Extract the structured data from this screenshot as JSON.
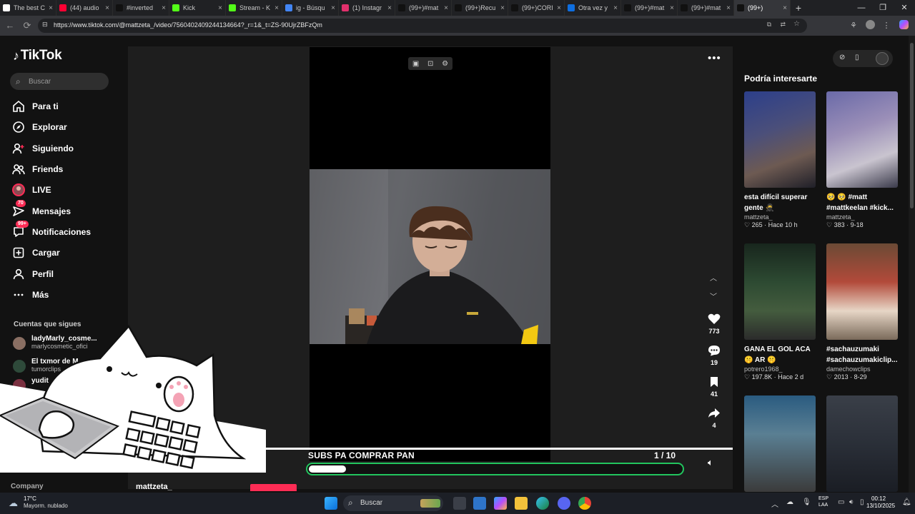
{
  "browser": {
    "tabs": [
      {
        "label": "The best C",
        "fav_color": "#444"
      },
      {
        "label": "The best C",
        "fav_color": "#fff"
      },
      {
        "label": "(44) audio",
        "fav_color": "#ff0033"
      },
      {
        "label": "#inverted",
        "fav_color": "#111"
      },
      {
        "label": "Kick",
        "fav_color": "#53fc18"
      },
      {
        "label": "Stream - K",
        "fav_color": "#53fc18"
      },
      {
        "label": "ig - Búsqu",
        "fav_color": "#4285f4"
      },
      {
        "label": "(1) Instagr",
        "fav_color": "#e1306c"
      },
      {
        "label": "(99+)#mat",
        "fav_color": "#111"
      },
      {
        "label": "(99+)Recu",
        "fav_color": "#111"
      },
      {
        "label": "(99+)CORI",
        "fav_color": "#111"
      },
      {
        "label": "Otra vez y",
        "fav_color": "#0e6ee0"
      },
      {
        "label": "(99+)#mat",
        "fav_color": "#111"
      },
      {
        "label": "(99+)#mat",
        "fav_color": "#111"
      },
      {
        "label": "(99+)",
        "fav_color": "#111"
      }
    ],
    "url": "https://www.tiktok.com/@mattzeta_/video/7560402409244134664?_r=1&_t=ZS-90UjrZBFzQm"
  },
  "sidebar": {
    "logo": "TikTok",
    "search_placeholder": "Buscar",
    "nav": [
      {
        "label": "Para ti",
        "icon": "home-icon"
      },
      {
        "label": "Explorar",
        "icon": "compass-icon"
      },
      {
        "label": "Siguiendo",
        "icon": "user-follow-icon"
      },
      {
        "label": "Friends",
        "icon": "friends-icon"
      },
      {
        "label": "LIVE",
        "icon": "live-icon"
      },
      {
        "label": "Mensajes",
        "icon": "messages-icon",
        "badge": "70"
      },
      {
        "label": "Notificaciones",
        "icon": "notifications-icon",
        "badge": "99+"
      },
      {
        "label": "Cargar",
        "icon": "upload-icon"
      },
      {
        "label": "Perfil",
        "icon": "profile-icon"
      },
      {
        "label": "Más",
        "icon": "more-icon"
      }
    ],
    "following_title": "Cuentas que sigues",
    "following": [
      {
        "name": "ladyMarly_cosme...",
        "handle": "marlycosmetic_ofici"
      },
      {
        "name": "El txmor de M",
        "handle": "tumorclips"
      },
      {
        "name": "yudit",
        "handle": ""
      }
    ],
    "company": "Company"
  },
  "player": {
    "actions": [
      {
        "icon": "heart-icon",
        "count": "773"
      },
      {
        "icon": "comment-icon",
        "count": "19"
      },
      {
        "icon": "bookmark-icon",
        "count": "41"
      },
      {
        "icon": "share-icon",
        "count": "4"
      }
    ],
    "author": "mattzeta_"
  },
  "overlay": {
    "goal_text": "SUBS PA COMPRAR PAN",
    "goal_count": "1  / 10",
    "goal_progress": 0.1,
    "goal_color": "#22c55e"
  },
  "recommended": {
    "title": "Podría interesarte",
    "cards": [
      {
        "caption": "esta difícil superar gente 🥷 mattkeelan...",
        "author": "mattzeta_",
        "likes": "265",
        "when": "Hace 10 h"
      },
      {
        "caption": "🥺 🥺 #matt #mattkeelan #kick...",
        "author": "mattzeta_",
        "likes": "383",
        "when": "9-18"
      },
      {
        "caption": "GANA EL GOL ACA 🤫 AR 🤫",
        "author": "potrero1968_",
        "likes": "197.8K",
        "when": "Hace 2 d"
      },
      {
        "caption": "#sachauzumaki #sachauzumakiclip...",
        "author": "damechowclips",
        "likes": "2013",
        "when": "8-29"
      },
      {
        "caption": "",
        "author": "",
        "likes": "",
        "when": ""
      },
      {
        "caption": "",
        "author": "",
        "likes": "",
        "when": ""
      }
    ]
  },
  "taskbar": {
    "weather_temp": "17°C",
    "weather_desc": "Mayorm. nublado",
    "search": "Buscar",
    "lang1": "ESP",
    "lang2": "LAA",
    "time": "00:12",
    "date": "13/10/2025"
  },
  "colors": {
    "tiktok_red": "#fe2c55",
    "background": "#121212"
  }
}
